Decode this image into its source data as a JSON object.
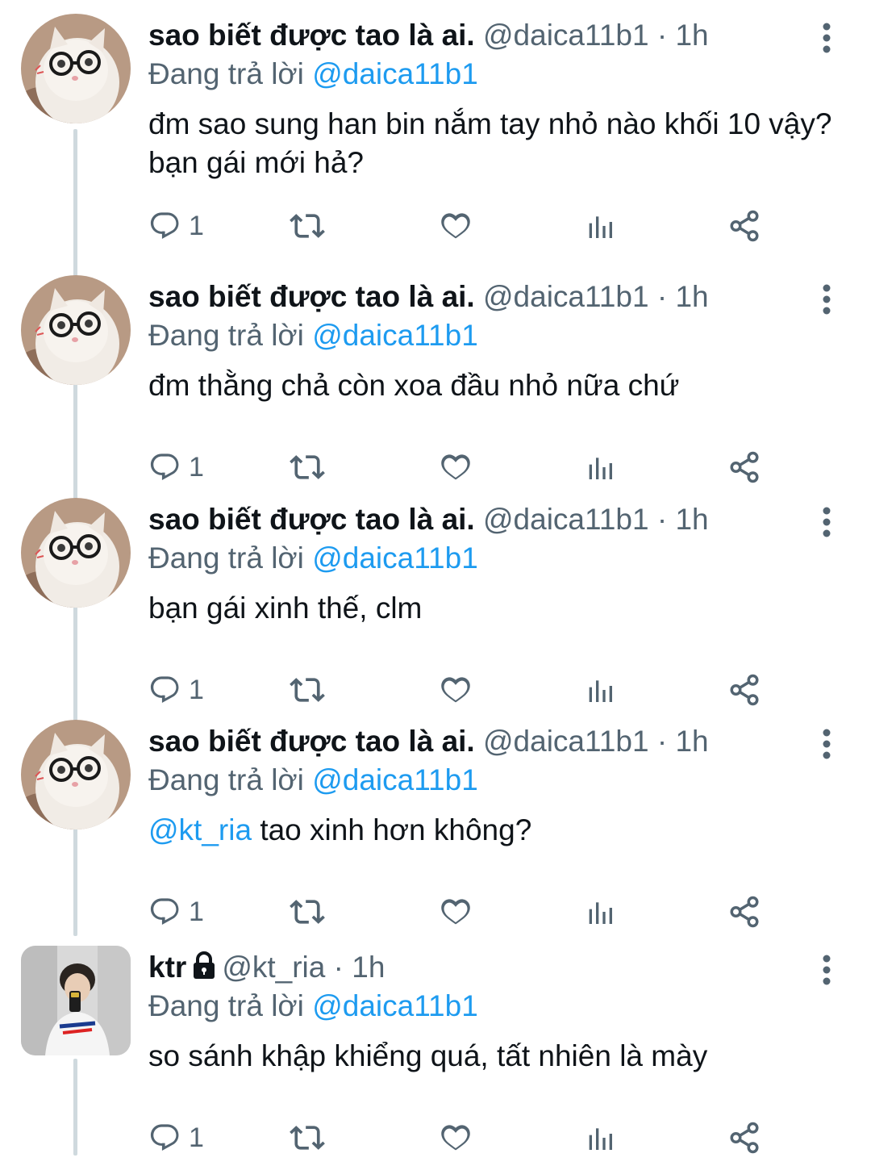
{
  "tweets": [
    {
      "name": "sao biết được tao là ai.",
      "handle": "@daica11b1",
      "dot": "·",
      "time": "1h",
      "reply_prefix": "Đang trả lời",
      "reply_to": "@daica11b1",
      "text": "đm sao sung han bin nắm tay nhỏ nào khối 10 vậy? bạn gái mới hả?",
      "mention": "",
      "reply_count": "1",
      "locked": false,
      "avatar": "cat-glasses-avatar"
    },
    {
      "name": "sao biết được tao là ai.",
      "handle": "@daica11b1",
      "dot": "·",
      "time": "1h",
      "reply_prefix": "Đang trả lời",
      "reply_to": "@daica11b1",
      "text": "đm thằng chả còn xoa đầu nhỏ nữa chứ",
      "mention": "",
      "reply_count": "1",
      "locked": false,
      "avatar": "cat-glasses-avatar"
    },
    {
      "name": "sao biết được tao là ai.",
      "handle": "@daica11b1",
      "dot": "·",
      "time": "1h",
      "reply_prefix": "Đang trả lời",
      "reply_to": "@daica11b1",
      "text": "bạn gái xinh thế, clm",
      "mention": "",
      "reply_count": "1",
      "locked": false,
      "avatar": "cat-glasses-avatar"
    },
    {
      "name": "sao biết được tao là ai.",
      "handle": "@daica11b1",
      "dot": "·",
      "time": "1h",
      "reply_prefix": "Đang trả lời",
      "reply_to": "@daica11b1",
      "text": "tao xinh hơn không?",
      "mention": "@kt_ria",
      "reply_count": "1",
      "locked": false,
      "avatar": "cat-glasses-avatar"
    },
    {
      "name": "ktr",
      "handle": "@kt_ria",
      "dot": "·",
      "time": "1h",
      "reply_prefix": "Đang trả lời",
      "reply_to": "@daica11b1",
      "text": "so sánh khập khiểng quá, tất nhiên là mày",
      "mention": "",
      "reply_count": "1",
      "locked": true,
      "avatar": "mirror-selfie-avatar"
    }
  ],
  "icons": {
    "reply": "reply-icon",
    "retweet": "retweet-icon",
    "like": "heart-icon",
    "views": "views-icon",
    "share": "share-icon",
    "more": "more-vertical-icon",
    "lock": "lock-icon"
  },
  "colors": {
    "link": "#1d9bf0",
    "secondary": "#536471",
    "thread_line": "#cfd9de"
  }
}
